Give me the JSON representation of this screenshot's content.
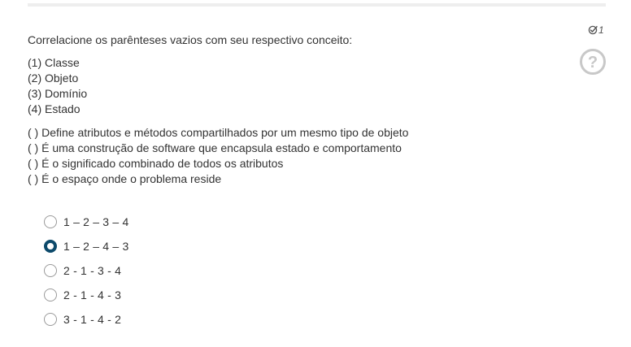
{
  "question": {
    "number": "1",
    "stem": "Correlacione os parênteses vazios com seu respectivo conceito:",
    "concepts": [
      "(1) Classe",
      "(2) Objeto",
      "(3) Domínio",
      "(4) Estado"
    ],
    "statements": [
      "( ) Define atributos e métodos compartilhados por um mesmo tipo de objeto",
      "( ) É uma construção de software que encapsula estado e comportamento",
      "( ) É o significado combinado de todos os atributos",
      "( ) É o espaço onde o problema reside"
    ],
    "options": [
      {
        "label": "1 – 2 – 3 – 4",
        "selected": false
      },
      {
        "label": "1 – 2 – 4 – 3",
        "selected": true
      },
      {
        "label": "2 - 1 - 3 - 4",
        "selected": false
      },
      {
        "label": "2 - 1 - 4 - 3",
        "selected": false
      },
      {
        "label": "3 - 1 - 4 - 2",
        "selected": false
      }
    ]
  },
  "icons": {
    "question_number_icon": "check-circle-icon",
    "help": "help-circle-icon"
  },
  "colors": {
    "selected_radio": "#0d4a6b",
    "help_icon": "#c8c8c8",
    "text": "#333333"
  }
}
